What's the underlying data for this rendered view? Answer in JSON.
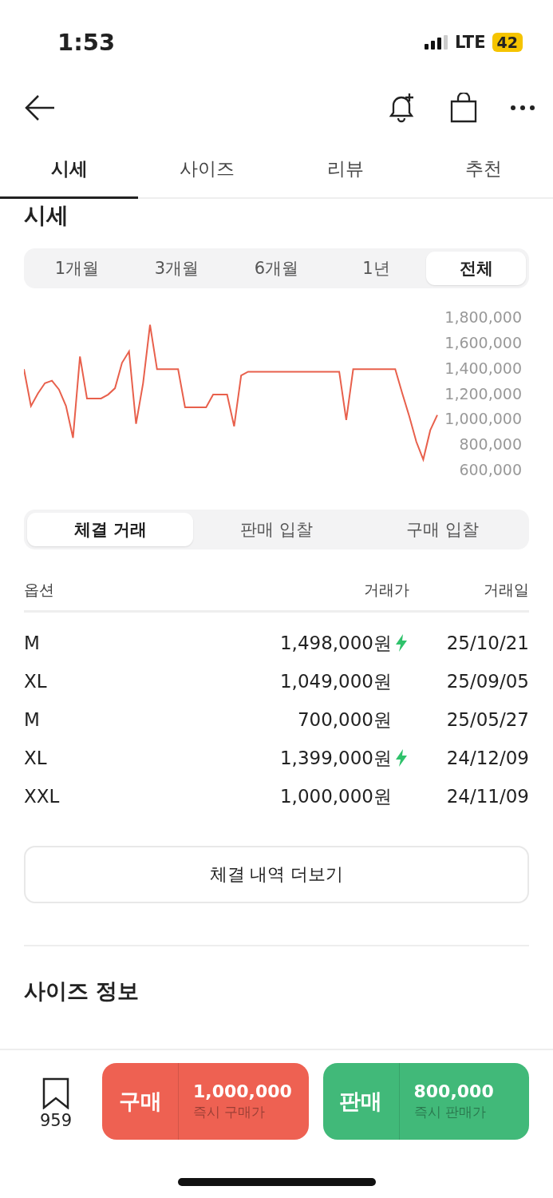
{
  "status_bar": {
    "time": "1:53",
    "network": "LTE",
    "battery": "42"
  },
  "tabs": [
    {
      "label": "시세",
      "selected": true
    },
    {
      "label": "사이즈",
      "selected": false
    },
    {
      "label": "리뷰",
      "selected": false
    },
    {
      "label": "추천",
      "selected": false
    }
  ],
  "section_title": "시세",
  "periods": [
    {
      "label": "1개월",
      "selected": false
    },
    {
      "label": "3개월",
      "selected": false
    },
    {
      "label": "6개월",
      "selected": false
    },
    {
      "label": "1년",
      "selected": false
    },
    {
      "label": "전체",
      "selected": true
    }
  ],
  "chart_data": {
    "type": "line",
    "ylim": [
      600000,
      1800000
    ],
    "yticks": [
      {
        "value": 1800000,
        "label": "1,800,000"
      },
      {
        "value": 1600000,
        "label": "1,600,000"
      },
      {
        "value": 1400000,
        "label": "1,400,000"
      },
      {
        "value": 1200000,
        "label": "1,200,000"
      },
      {
        "value": 1000000,
        "label": "1,000,000"
      },
      {
        "value": 800000,
        "label": "800,000"
      },
      {
        "value": 600000,
        "label": "600,000"
      }
    ],
    "series": [
      {
        "color": "#e8604c",
        "values": [
          1390000,
          1100000,
          1200000,
          1280000,
          1300000,
          1230000,
          1100000,
          850000,
          1490000,
          1160000,
          1160000,
          1160000,
          1190000,
          1240000,
          1440000,
          1530000,
          960000,
          1280000,
          1740000,
          1390000,
          1390000,
          1390000,
          1390000,
          1090000,
          1090000,
          1090000,
          1090000,
          1190000,
          1190000,
          1190000,
          940000,
          1340000,
          1370000,
          1370000,
          1370000,
          1370000,
          1370000,
          1370000,
          1370000,
          1370000,
          1370000,
          1370000,
          1370000,
          1370000,
          1370000,
          1370000,
          990000,
          1390000,
          1390000,
          1390000,
          1390000,
          1390000,
          1390000,
          1390000,
          1200000,
          1020000,
          820000,
          680000,
          910000,
          1030000
        ]
      }
    ]
  },
  "trade_tabs": [
    {
      "label": "체결 거래",
      "selected": true
    },
    {
      "label": "판매 입찰",
      "selected": false
    },
    {
      "label": "구매 입찰",
      "selected": false
    }
  ],
  "table": {
    "columns": [
      "옵션",
      "거래가",
      "거래일"
    ],
    "rows": [
      {
        "option": "M",
        "price": "1,498,000원",
        "instant": true,
        "date": "25/10/21"
      },
      {
        "option": "XL",
        "price": "1,049,000원",
        "instant": false,
        "date": "25/09/05"
      },
      {
        "option": "M",
        "price": "700,000원",
        "instant": false,
        "date": "25/05/27"
      },
      {
        "option": "XL",
        "price": "1,399,000원",
        "instant": true,
        "date": "24/12/09"
      },
      {
        "option": "XXL",
        "price": "1,000,000원",
        "instant": false,
        "date": "24/11/09"
      }
    ]
  },
  "more_button": "체결 내역 더보기",
  "size_info_title": "사이즈 정보",
  "bottom_bar": {
    "wish_count": "959",
    "actions": [
      {
        "kind": "buy",
        "label": "구매",
        "price": "1,000,000",
        "caption": "즉시 구매가"
      },
      {
        "kind": "sell",
        "label": "판매",
        "price": "800,000",
        "caption": "즉시 판매가"
      }
    ]
  }
}
